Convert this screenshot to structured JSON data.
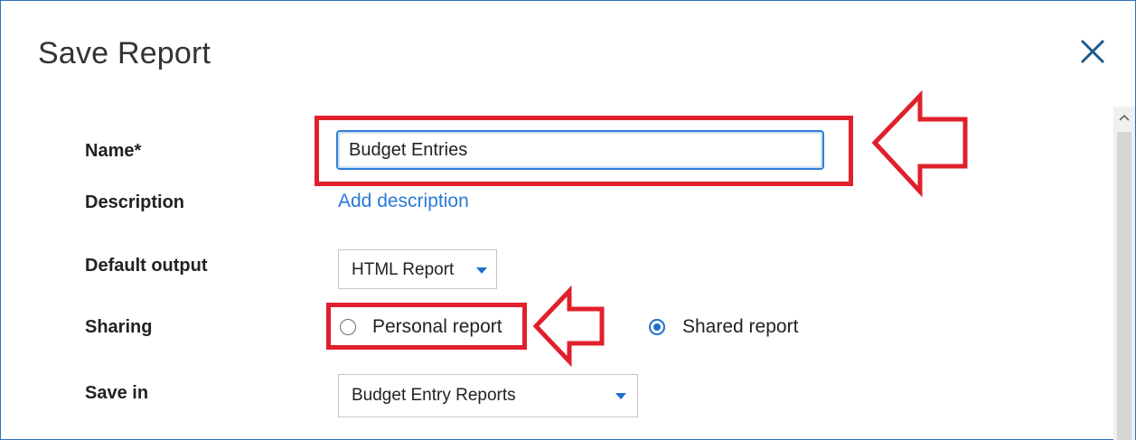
{
  "dialog": {
    "title": "Save Report",
    "close_icon": "close-icon"
  },
  "form": {
    "name": {
      "label": "Name*",
      "value": "Budget Entries"
    },
    "description": {
      "label": "Description",
      "link_text": "Add description"
    },
    "default_output": {
      "label": "Default output",
      "selected": "HTML Report"
    },
    "sharing": {
      "label": "Sharing",
      "options": [
        {
          "label": "Personal report",
          "checked": false
        },
        {
          "label": "Shared report",
          "checked": true
        }
      ]
    },
    "save_in": {
      "label": "Save in",
      "selected": "Budget Entry Reports"
    }
  },
  "annotations": {
    "highlight_color": "#e0202b",
    "arrow_icon": "arrow-left-icon"
  },
  "colors": {
    "accent": "#2a7ad6",
    "frame_border": "#2f6fbf"
  }
}
